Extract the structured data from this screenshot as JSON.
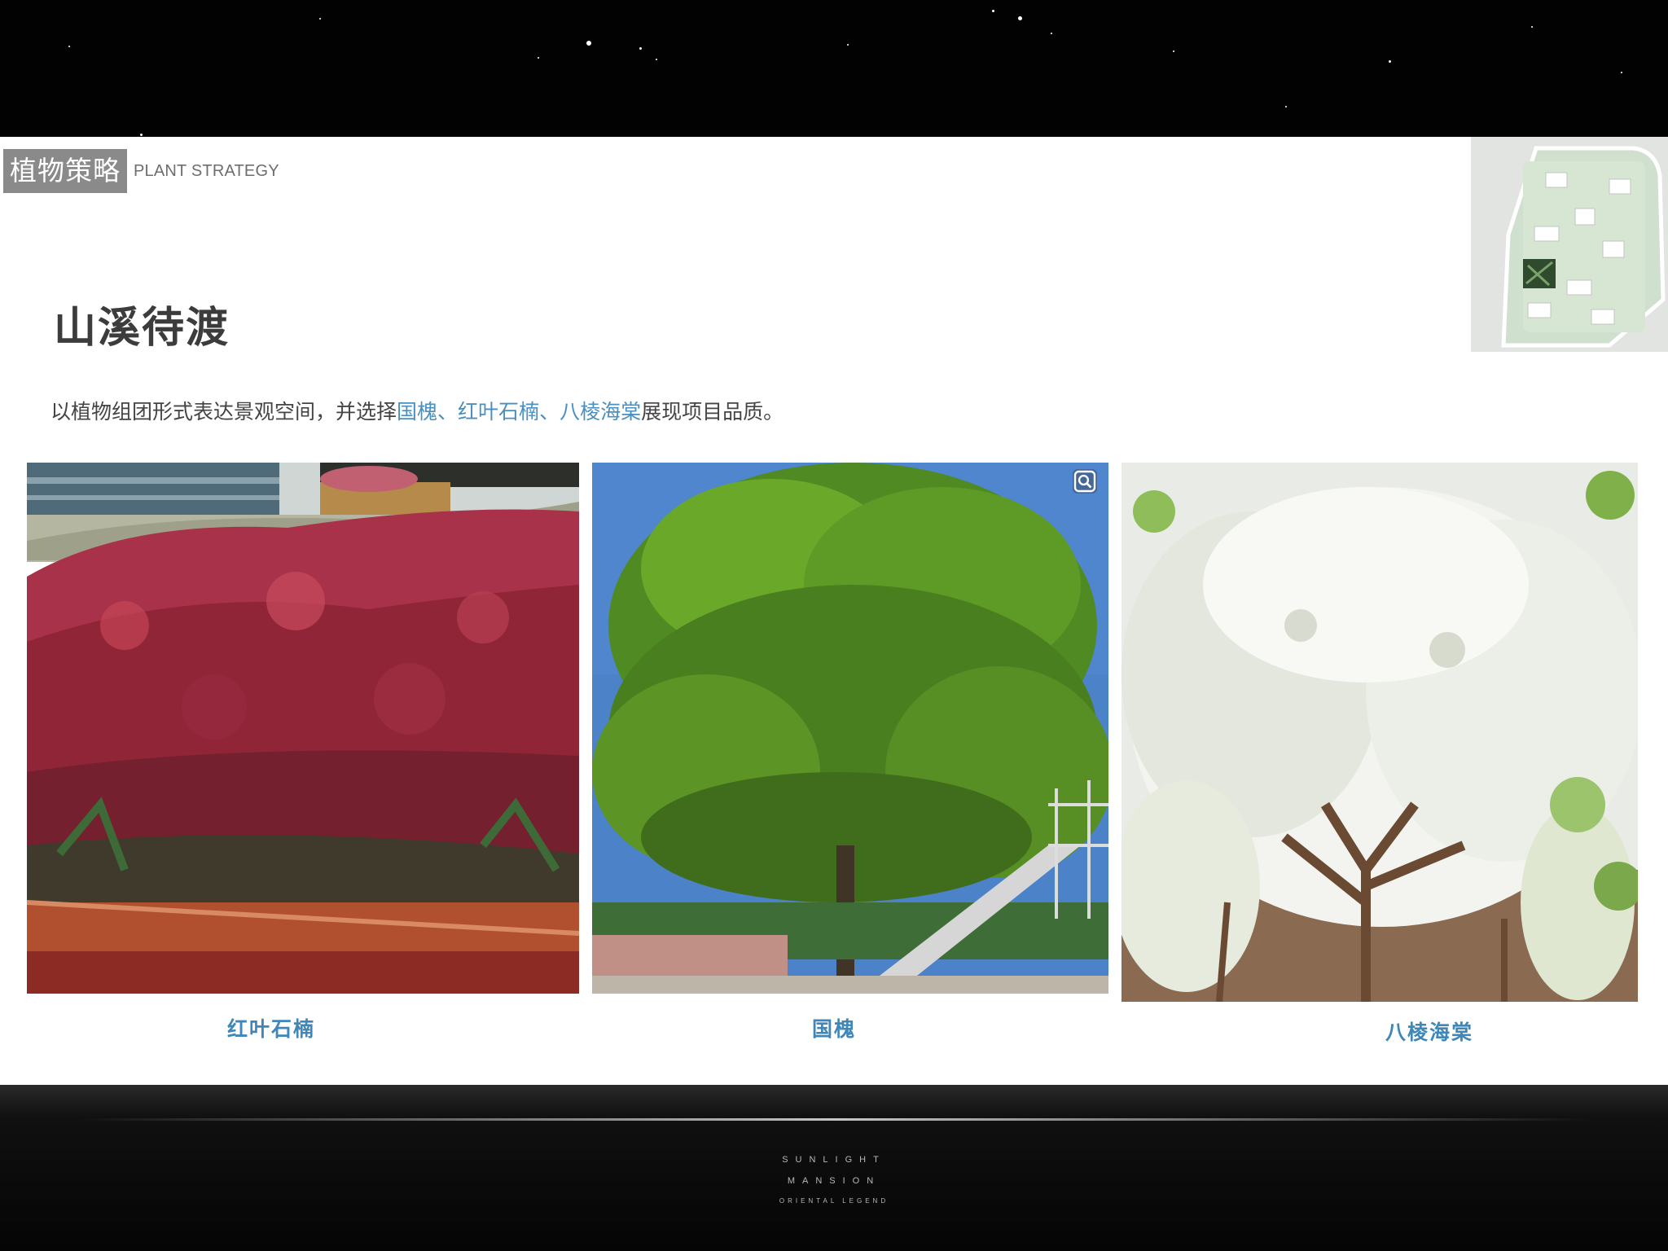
{
  "header": {
    "section_cn": "植物策略",
    "section_en": "PLANT STRATEGY"
  },
  "main": {
    "title": "山溪待渡",
    "intro_prefix": "以植物组团形式表达景观空间，并选择",
    "intro_plant_1": "国槐",
    "intro_sep_1": "、",
    "intro_plant_2": "红叶石楠",
    "intro_sep_2": "、",
    "intro_plant_3": "八棱海棠",
    "intro_suffix": "展现项目品质。"
  },
  "photos": [
    {
      "caption": "红叶石楠",
      "icon": "photinia-hedge-image"
    },
    {
      "caption": "国槐",
      "icon": "pagoda-tree-image"
    },
    {
      "caption": "八棱海棠",
      "icon": "crabapple-blossom-image"
    }
  ],
  "footer": {
    "line_1": "SUNLIGHT",
    "line_2": "MANSION",
    "line_3": "ORIENTAL LEGEND"
  },
  "colors": {
    "highlight": "#4b8fbf",
    "caption": "#3f87b8",
    "tag_bg": "#8a8a8a"
  }
}
